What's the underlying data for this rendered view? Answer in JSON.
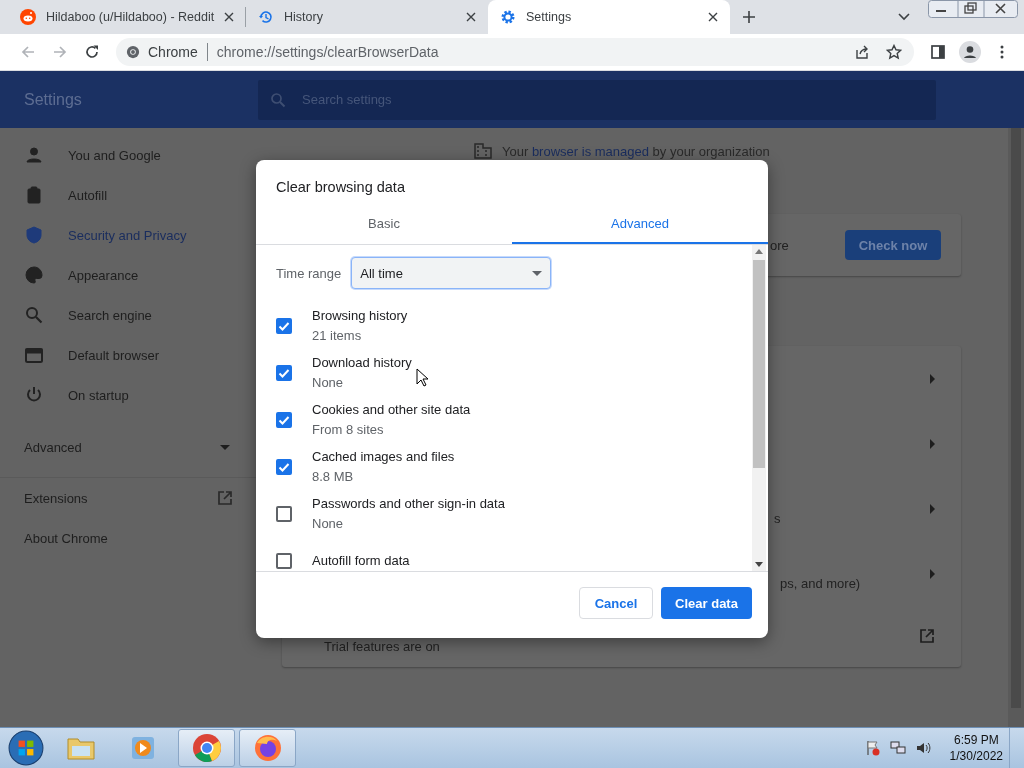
{
  "browser": {
    "tabs": [
      {
        "kind": "reddit",
        "title": "Hildaboo (u/Hildaboo) - Reddit",
        "selected": false
      },
      {
        "kind": "history",
        "title": "History",
        "selected": false
      },
      {
        "kind": "settings",
        "title": "Settings",
        "selected": true
      }
    ],
    "address": {
      "site_label": "Chrome",
      "url": "chrome://settings/clearBrowserData"
    }
  },
  "settings": {
    "header_title": "Settings",
    "search": {
      "placeholder": "Search settings"
    },
    "sidebar": {
      "items": [
        {
          "kind": "person",
          "label": "You and Google",
          "selected": false
        },
        {
          "kind": "clipboard",
          "label": "Autofill",
          "selected": false
        },
        {
          "kind": "shield",
          "label": "Security and Privacy",
          "selected": true
        },
        {
          "kind": "palette",
          "label": "Appearance",
          "selected": false
        },
        {
          "kind": "search",
          "label": "Search engine",
          "selected": false
        },
        {
          "kind": "browser",
          "label": "Default browser",
          "selected": false
        },
        {
          "kind": "power",
          "label": "On startup",
          "selected": false
        }
      ],
      "advanced": "Advanced",
      "extensions": "Extensions",
      "about": "About Chrome"
    },
    "managed_notice": {
      "before": "Your",
      "link": "browser is managed",
      "after": "by your organization"
    },
    "safety_check": {
      "text_fragment": "ore",
      "button": "Check now"
    },
    "privacy_rows": [
      {},
      {},
      {
        "text_fragment": "s"
      },
      {
        "text_fragment": "ps, and more)"
      },
      {
        "text_fragment": "Trial features are on"
      }
    ]
  },
  "dialog": {
    "title": "Clear browsing data",
    "tabs": [
      {
        "label": "Basic",
        "selected": false
      },
      {
        "label": "Advanced",
        "selected": true
      }
    ],
    "time_range": {
      "label": "Time range",
      "value": "All time"
    },
    "items": [
      {
        "title": "Browsing history",
        "detail": "21 items",
        "checked": true
      },
      {
        "title": "Download history",
        "detail": "None",
        "checked": true
      },
      {
        "title": "Cookies and other site data",
        "detail": "From 8 sites",
        "checked": true
      },
      {
        "title": "Cached images and files",
        "detail": "8.8 MB",
        "checked": true
      },
      {
        "title": "Passwords and other sign-in data",
        "detail": "None",
        "checked": false
      },
      {
        "title": "Autofill form data",
        "checked": false
      }
    ],
    "cancel": "Cancel",
    "confirm": "Clear data"
  },
  "taskbar": {
    "time": "6:59 PM",
    "date": "1/30/2022"
  }
}
